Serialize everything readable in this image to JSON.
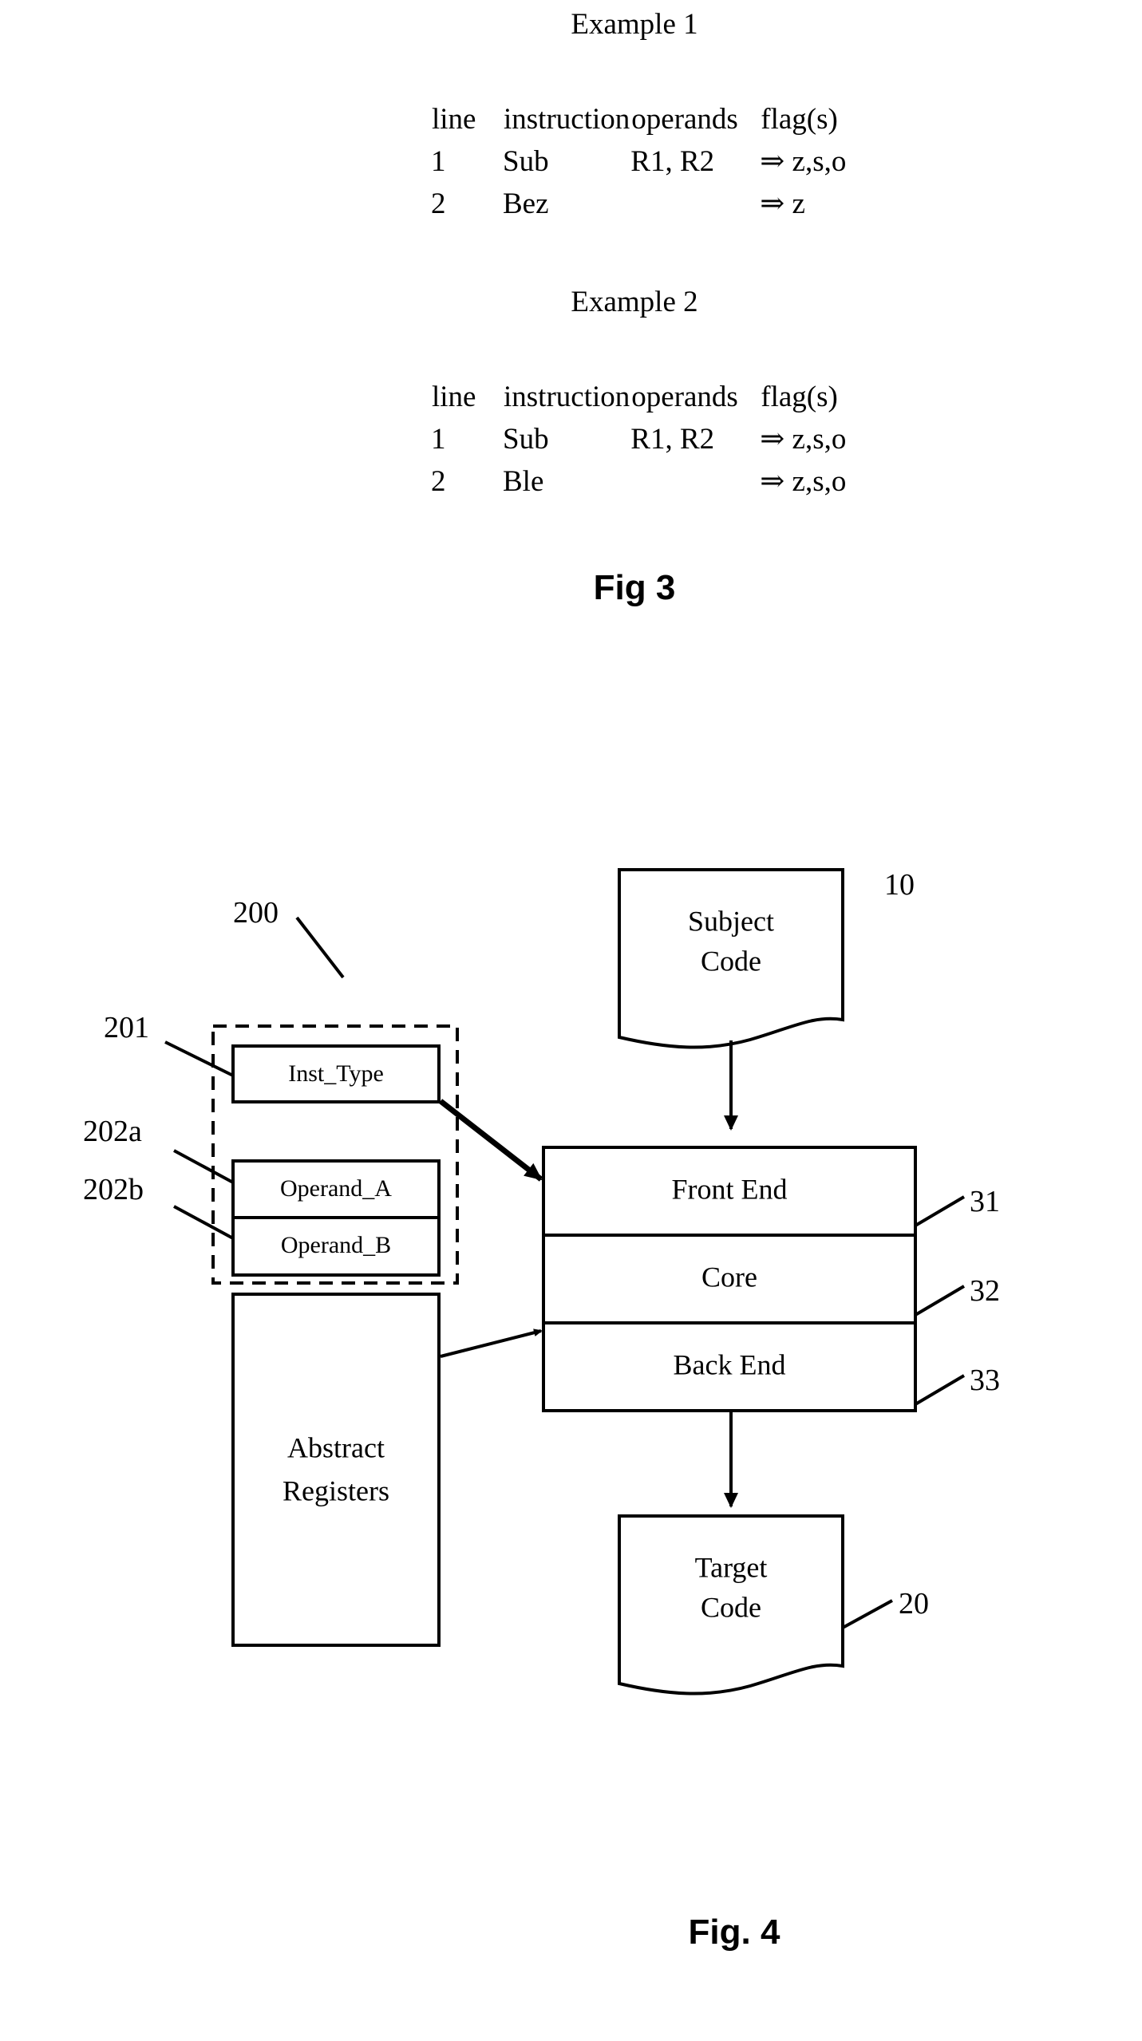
{
  "figure3": {
    "examples": [
      {
        "title": "Example 1",
        "columns": [
          "line",
          "instruction",
          "operands",
          "flag(s)"
        ],
        "rows": [
          {
            "line": "1",
            "instruction": "Sub",
            "operands": "R1, R2",
            "flags": "⇒ z,s,o"
          },
          {
            "line": "2",
            "instruction": "Bez",
            "operands": "",
            "flags": "⇒ z"
          }
        ]
      },
      {
        "title": "Example 2",
        "columns": [
          "line",
          "instruction",
          "operands",
          "flag(s)"
        ],
        "rows": [
          {
            "line": "1",
            "instruction": "Sub",
            "operands": "R1, R2",
            "flags": "⇒ z,s,o"
          },
          {
            "line": "2",
            "instruction": "Ble",
            "operands": "",
            "flags": "⇒ z,s,o"
          }
        ]
      }
    ],
    "caption": "Fig 3"
  },
  "figure4": {
    "caption": "Fig. 4",
    "blocks": {
      "subject_code": "Subject\nCode",
      "subject_code_line1": "Subject",
      "subject_code_line2": "Code",
      "target_code_line1": "Target",
      "target_code_line2": "Code",
      "inst_type": "Inst_Type",
      "operand_a": "Operand_A",
      "operand_b": "Operand_B",
      "abstract_registers_line1": "Abstract",
      "abstract_registers_line2": "Registers",
      "front_end": "Front End",
      "core": "Core",
      "back_end": "Back End"
    },
    "reference_numerals": {
      "subject_code": "10",
      "target_code": "20",
      "front_end": "31",
      "core": "32",
      "back_end": "33",
      "ir_group": "200",
      "inst_type": "201",
      "operand_a": "202a",
      "operand_b": "202b"
    }
  },
  "colors": {
    "ink": "#000000",
    "paper": "#ffffff"
  }
}
